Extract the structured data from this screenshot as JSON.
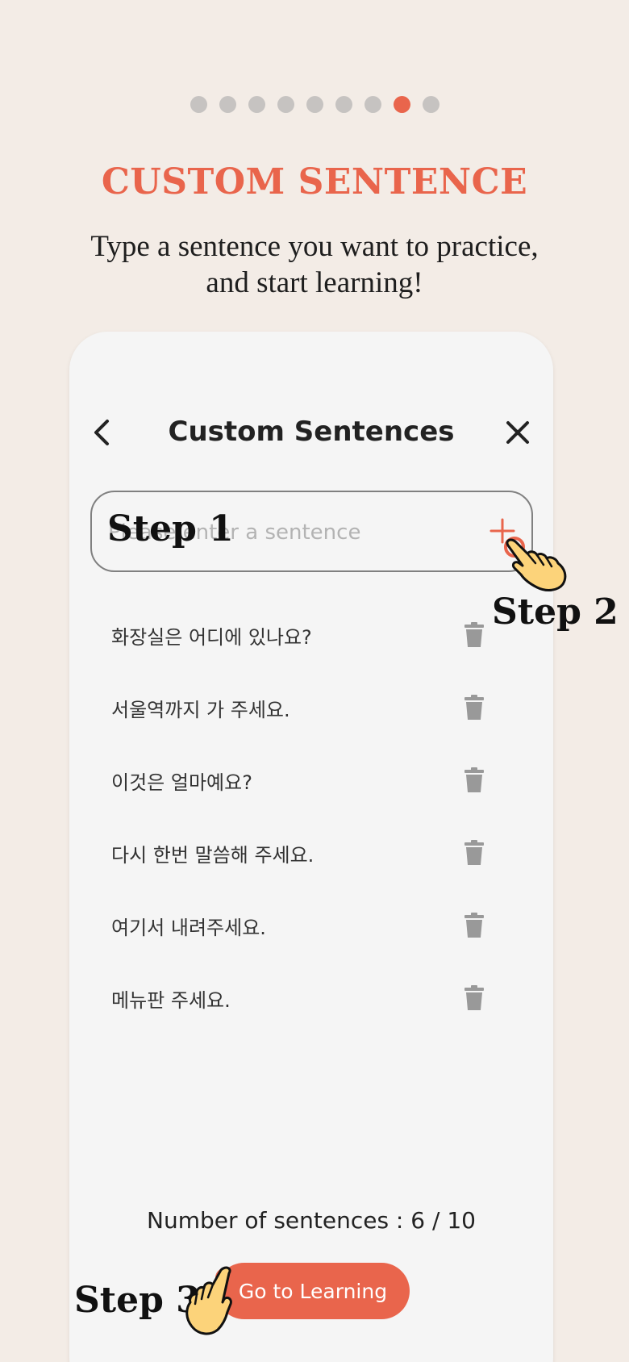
{
  "pagination": {
    "count": 9,
    "active_index": 7
  },
  "headline": "CUSTOM SENTENCE",
  "subtitle_line1": "Type a sentence you want to practice,",
  "subtitle_line2": "and start learning!",
  "screen": {
    "title": "Custom Sentences",
    "back_icon": "chevron-left-icon",
    "close_icon": "close-icon",
    "input_placeholder": "Please enter a sentence",
    "add_icon": "plus-icon",
    "sentences": [
      "화장실은 어디에 있나요?",
      "서울역까지 가 주세요.",
      "이것은 얼마예요?",
      "다시 한번 말씀해 주세요.",
      "여기서 내려주세요.",
      "메뉴판 주세요."
    ],
    "delete_icon": "trash-icon",
    "count_label": "Number of sentences : 6 / 10",
    "go_button": "Go to Learning"
  },
  "steps": {
    "step1": "Step 1",
    "step2": "Step 2",
    "step3": "Step 3"
  },
  "colors": {
    "accent": "#e9654c",
    "background": "#f3ece6",
    "screen": "#f5f5f5",
    "dot_inactive": "#c6c3c1"
  }
}
